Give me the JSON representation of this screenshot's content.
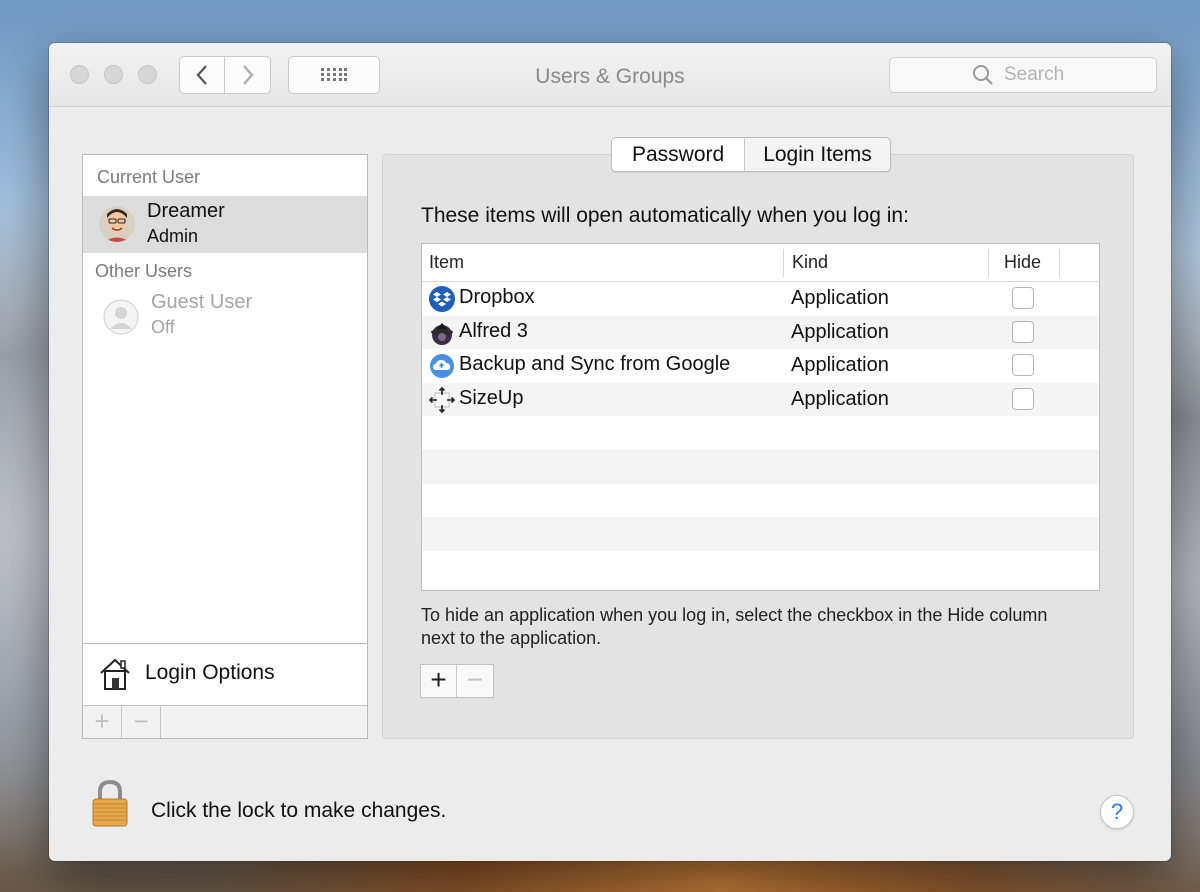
{
  "window": {
    "title": "Users & Groups",
    "search_placeholder": "Search"
  },
  "sidebar": {
    "current_user_label": "Current User",
    "current_user": {
      "name": "Dreamer",
      "role": "Admin"
    },
    "other_users_label": "Other Users",
    "other_users": [
      {
        "name": "Guest User",
        "status": "Off"
      }
    ],
    "login_options_label": "Login Options",
    "add_label": "+",
    "remove_label": "−"
  },
  "tabs": [
    {
      "label": "Password",
      "active": true
    },
    {
      "label": "Login Items",
      "active": false
    }
  ],
  "login_items": {
    "intro": "These items will open automatically when you log in:",
    "columns": {
      "item": "Item",
      "kind": "Kind",
      "hide": "Hide"
    },
    "items": [
      {
        "name": "Dropbox",
        "kind": "Application",
        "hide": false,
        "icon": "dropbox-icon"
      },
      {
        "name": "Alfred 3",
        "kind": "Application",
        "hide": false,
        "icon": "alfred-icon"
      },
      {
        "name": "Backup and Sync from Google",
        "kind": "Application",
        "hide": false,
        "icon": "google-backup-icon"
      },
      {
        "name": "SizeUp",
        "kind": "Application",
        "hide": false,
        "icon": "sizeup-icon"
      }
    ],
    "hint": "To hide an application when you log in, select the checkbox in the Hide column next to the application.",
    "add_label": "+",
    "remove_label": "−"
  },
  "footer": {
    "lock_text": "Click the lock to make changes.",
    "help_label": "?"
  }
}
